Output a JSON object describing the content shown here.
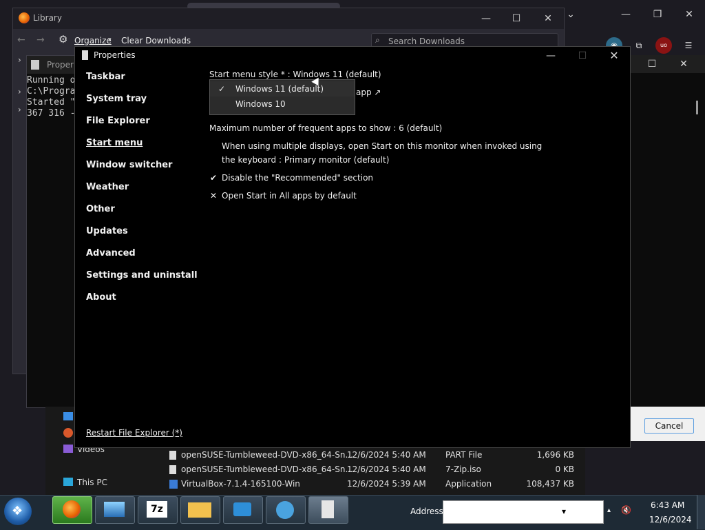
{
  "browser": {
    "window_controls": {
      "minimize": "—",
      "maximize": "❐",
      "close": "✕"
    },
    "chevron": "⌄"
  },
  "library": {
    "title": "Library",
    "organize": "Organize",
    "clear_downloads": "Clear Downloads",
    "search_placeholder": "Search Downloads",
    "controls": {
      "minimize": "—",
      "maximize": "☐",
      "close": "✕"
    }
  },
  "console": {
    "title": "Proper",
    "lines": [
      "Running o",
      "C:\\Progra",
      "Started \"",
      "367 316 -"
    ]
  },
  "right_window": {
    "cancel": "Cancel"
  },
  "explorer": {
    "nav": {
      "videos": "Videos",
      "this_pc": "This PC"
    },
    "files": [
      {
        "name": "openSUSE-Tumbleweed-DVD-x86_64-Sn...",
        "date": "12/6/2024 5:40 AM",
        "type": "PART File",
        "size": "1,696 KB"
      },
      {
        "name": "openSUSE-Tumbleweed-DVD-x86_64-Sn...",
        "date": "12/6/2024 5:40 AM",
        "type": "7-Zip.iso",
        "size": "0 KB"
      },
      {
        "name": "VirtualBox-7.1.4-165100-Win",
        "date": "12/6/2024 5:39 AM",
        "type": "Application",
        "size": "108,437 KB"
      }
    ]
  },
  "properties": {
    "title": "Properties",
    "categories": [
      "Taskbar",
      "System tray",
      "File Explorer",
      "Start menu",
      "Window switcher",
      "Weather",
      "Other",
      "Updates",
      "Advanced",
      "Settings and uninstall",
      "About"
    ],
    "active_category": "Start menu",
    "restart": "Restart File Explorer (*)",
    "start_menu_style": "Start menu style * : Windows 11 (default)",
    "app_link_fragment": "app ↗",
    "dropdown": {
      "options": [
        "Windows 11 (default)",
        "Windows 10"
      ],
      "selected": "Windows 11 (default)",
      "check": "✓"
    },
    "max_frequent": "Maximum number of frequent apps to show : 6 (default)",
    "multi_display_1": "When using multiple displays, open Start on this monitor when invoked using",
    "multi_display_2": "the keyboard : Primary monitor (default)",
    "disable_recommended": "Disable the \"Recommended\" section",
    "open_all_apps": "Open Start in All apps by default",
    "check_on": "✔",
    "check_off": "✕",
    "controls": {
      "minimize": "—",
      "maximize": "☐",
      "close": "✕"
    }
  },
  "taskbar": {
    "address_label": "Address",
    "dropdown_arrow": "▾",
    "tray_arrow": "▴",
    "volume": "🔇",
    "time": "6:43 AM",
    "date": "12/6/2024"
  }
}
